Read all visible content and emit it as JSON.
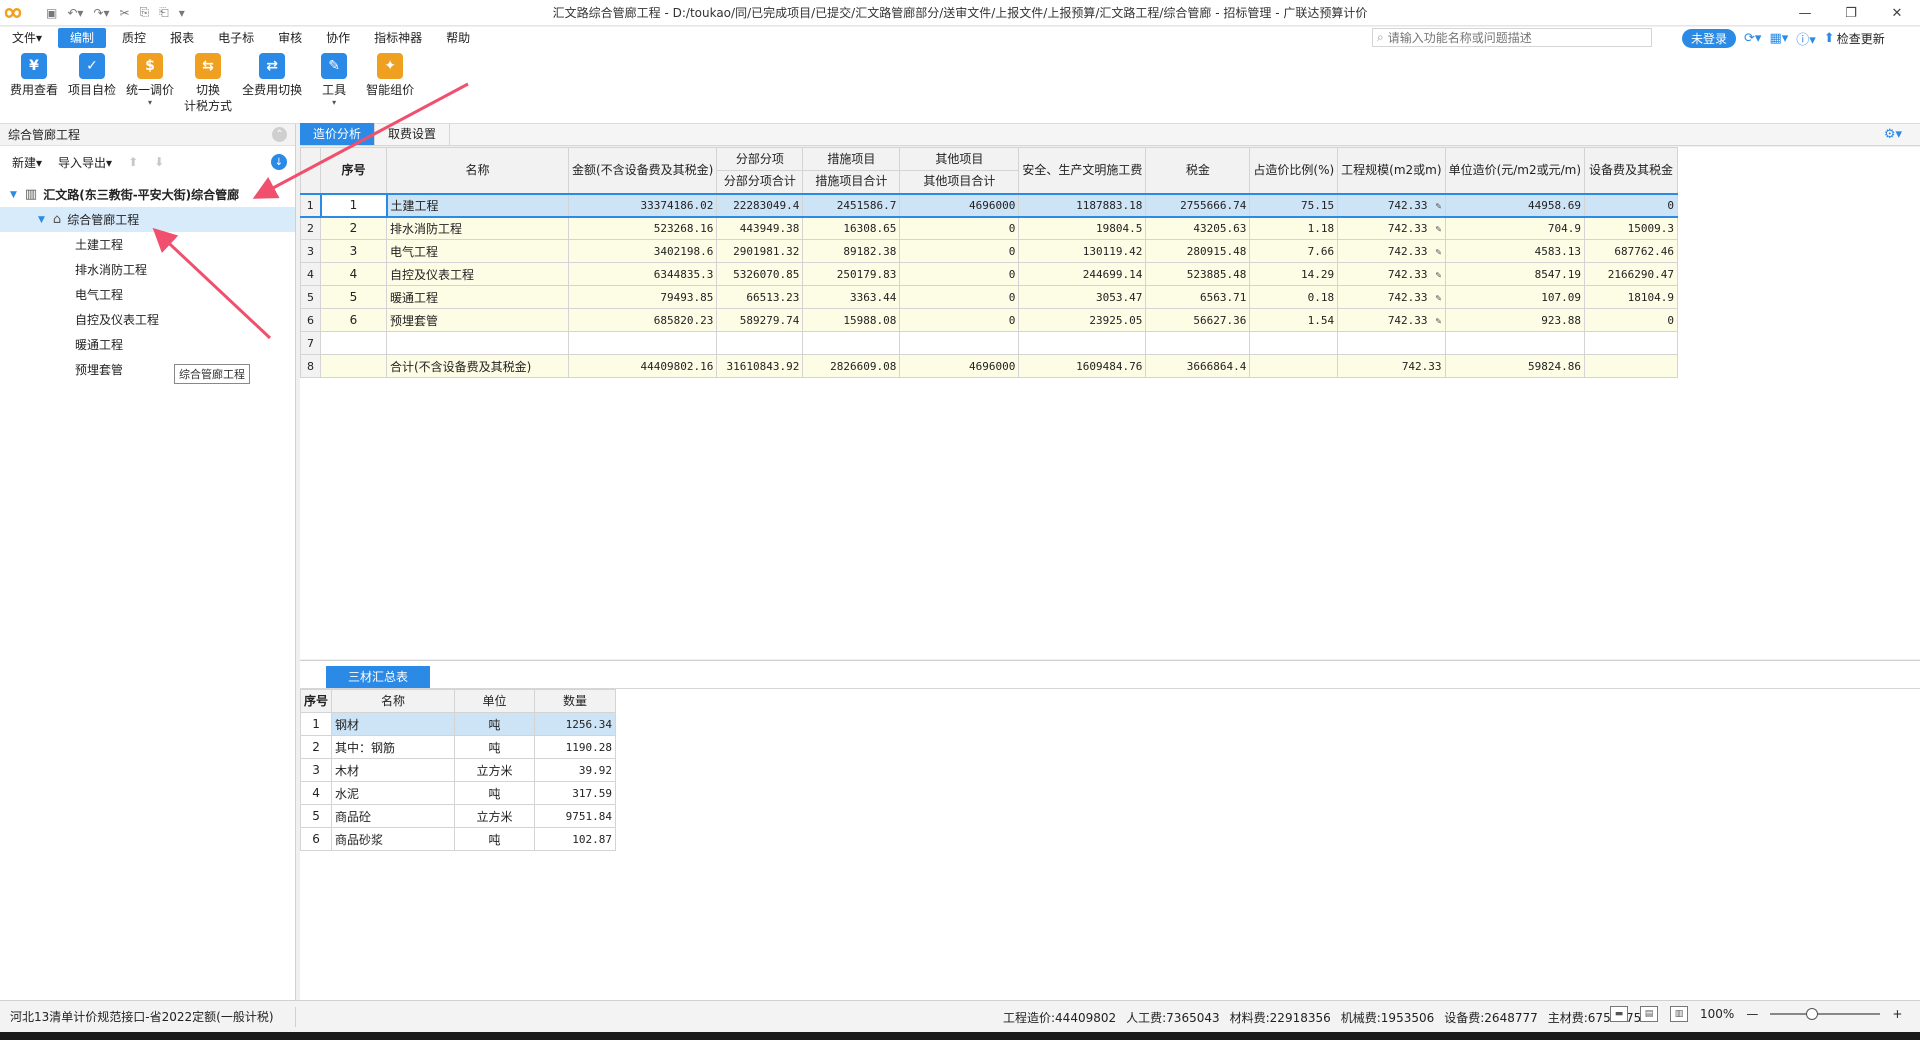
{
  "window": {
    "title": "汇文路综合管廊工程 - D:/toukao/同/已完成项目/已提交/汇文路管廊部分/送审文件/上报文件/上报预算/汇文路工程/综合管廊 - 招标管理 - 广联达预算计价",
    "controls": {
      "minimize": "—",
      "restore": "❐",
      "close": "✕"
    }
  },
  "menu": {
    "items": [
      "文件▾",
      "编制",
      "质控",
      "报表",
      "电子标",
      "审核",
      "协作",
      "指标神器",
      "帮助"
    ],
    "active_index": 1,
    "search_placeholder": "请输入功能名称或问题描述",
    "login_label": "未登录",
    "update_label": "检查更新"
  },
  "ribbon": {
    "buttons": [
      {
        "label": "费用查看",
        "icon": "fee-view-icon",
        "color": "#2a8ae6",
        "glyph": "¥"
      },
      {
        "label": "项目自检",
        "icon": "project-check-icon",
        "color": "#2a8ae6",
        "glyph": "✓"
      },
      {
        "label": "统一调价",
        "icon": "price-adjust-icon",
        "color": "#f0a020",
        "glyph": "$",
        "dropdown": "▾"
      },
      {
        "label": "切换\n计税方式",
        "icon": "tax-switch-icon",
        "color": "#f0a020",
        "glyph": "⇆"
      },
      {
        "label": "全费用切换",
        "icon": "full-cost-switch-icon",
        "color": "#2a8ae6",
        "glyph": "⇄"
      },
      {
        "label": "工具",
        "icon": "tools-icon",
        "color": "#2a8ae6",
        "glyph": "✎",
        "dropdown": "▾"
      },
      {
        "label": "智能组价",
        "icon": "smart-pricing-icon",
        "color": "#f0a020",
        "glyph": "✦"
      }
    ]
  },
  "left_panel": {
    "title": "综合管廊工程",
    "tools": {
      "new": "新建▾",
      "import_export": "导入导出▾"
    },
    "tree": {
      "root": "汇文路(东三教街-平安大街)综合管廊",
      "project": "综合管廊工程",
      "children": [
        "土建工程",
        "排水消防工程",
        "电气工程",
        "自控及仪表工程",
        "暖通工程",
        "预埋套管"
      ]
    },
    "tooltip": "综合管廊工程"
  },
  "content_tabs": [
    "造价分析",
    "取费设置"
  ],
  "main_table": {
    "headers": {
      "seq": "序号",
      "name": "名称",
      "amount": "金额(不含设备费及其税金)",
      "fbfx": "分部分项",
      "fbfx_sub": "分部分项合计",
      "csxm": "措施项目",
      "csxm_sub": "措施项目合计",
      "qtxm": "其他项目",
      "qtxm_sub": "其他项目合计",
      "safety": "安全、生产文明施工费",
      "tax": "税金",
      "ratio": "占造价比例(%)",
      "scale": "工程规模(m2或m)",
      "unit_cost": "单位造价(元/m2或元/m)",
      "equip": "设备费及其税金"
    },
    "rows": [
      {
        "no": "1",
        "seq": "1",
        "name": "土建工程",
        "amount": "33374186.02",
        "fbfx": "22283049.4",
        "csxm": "2451586.7",
        "qtxm": "4696000",
        "safety": "1187883.18",
        "tax": "2755666.74",
        "ratio": "75.15",
        "scale": "742.33",
        "unit_cost": "44958.69",
        "equip": "0",
        "edit": true
      },
      {
        "no": "2",
        "seq": "2",
        "name": "排水消防工程",
        "amount": "523268.16",
        "fbfx": "443949.38",
        "csxm": "16308.65",
        "qtxm": "0",
        "safety": "19804.5",
        "tax": "43205.63",
        "ratio": "1.18",
        "scale": "742.33",
        "unit_cost": "704.9",
        "equip": "15009.3",
        "edit": true
      },
      {
        "no": "3",
        "seq": "3",
        "name": "电气工程",
        "amount": "3402198.6",
        "fbfx": "2901981.32",
        "csxm": "89182.38",
        "qtxm": "0",
        "safety": "130119.42",
        "tax": "280915.48",
        "ratio": "7.66",
        "scale": "742.33",
        "unit_cost": "4583.13",
        "equip": "687762.46",
        "edit": true
      },
      {
        "no": "4",
        "seq": "4",
        "name": "自控及仪表工程",
        "amount": "6344835.3",
        "fbfx": "5326070.85",
        "csxm": "250179.83",
        "qtxm": "0",
        "safety": "244699.14",
        "tax": "523885.48",
        "ratio": "14.29",
        "scale": "742.33",
        "unit_cost": "8547.19",
        "equip": "2166290.47",
        "edit": true
      },
      {
        "no": "5",
        "seq": "5",
        "name": "暖通工程",
        "amount": "79493.85",
        "fbfx": "66513.23",
        "csxm": "3363.44",
        "qtxm": "0",
        "safety": "3053.47",
        "tax": "6563.71",
        "ratio": "0.18",
        "scale": "742.33",
        "unit_cost": "107.09",
        "equip": "18104.9",
        "edit": true
      },
      {
        "no": "6",
        "seq": "6",
        "name": "预埋套管",
        "amount": "685820.23",
        "fbfx": "589279.74",
        "csxm": "15988.08",
        "qtxm": "0",
        "safety": "23925.05",
        "tax": "56627.36",
        "ratio": "1.54",
        "scale": "742.33",
        "unit_cost": "923.88",
        "equip": "0",
        "edit": true
      },
      {
        "no": "7",
        "seq": "",
        "name": "",
        "amount": "",
        "fbfx": "",
        "csxm": "",
        "qtxm": "",
        "safety": "",
        "tax": "",
        "ratio": "",
        "scale": "",
        "unit_cost": "",
        "equip": "",
        "edit": false
      },
      {
        "no": "8",
        "seq": "",
        "name": "合计(不含设备费及其税金)",
        "amount": "44409802.16",
        "fbfx": "31610843.92",
        "csxm": "2826609.08",
        "qtxm": "4696000",
        "safety": "1609484.76",
        "tax": "3666864.4",
        "ratio": "",
        "scale": "742.33",
        "unit_cost": "59824.86",
        "equip": "",
        "edit": false
      }
    ]
  },
  "bottom_tab": "三材汇总表",
  "materials_table": {
    "headers": {
      "seq": "序号",
      "name": "名称",
      "unit": "单位",
      "qty": "数量"
    },
    "rows": [
      {
        "seq": "1",
        "name": "钢材",
        "unit": "吨",
        "qty": "1256.34"
      },
      {
        "seq": "2",
        "name": "其中：钢筋",
        "unit": "吨",
        "qty": "1190.28"
      },
      {
        "seq": "3",
        "name": "木材",
        "unit": "立方米",
        "qty": "39.92"
      },
      {
        "seq": "4",
        "name": "水泥",
        "unit": "吨",
        "qty": "317.59"
      },
      {
        "seq": "5",
        "name": "商品砼",
        "unit": "立方米",
        "qty": "9751.84"
      },
      {
        "seq": "6",
        "name": "商品砂浆",
        "unit": "吨",
        "qty": "102.87"
      }
    ]
  },
  "status": {
    "standard": "河北13清单计价规范接口-省2022定额(一般计税)",
    "stats": [
      "工程造价:44409802",
      "人工费:7365043",
      "材料费:22918356",
      "机械费:1953506",
      "设备费:2648777",
      "主材费:6757275"
    ],
    "zoom": "100%",
    "zoom_minus": "—",
    "zoom_plus": "+"
  },
  "colors": {
    "accent": "#2a8ae6",
    "annotation_arrow": "#f0506e",
    "row_highlight": "#fdfce5",
    "selection": "#cde4f7"
  }
}
